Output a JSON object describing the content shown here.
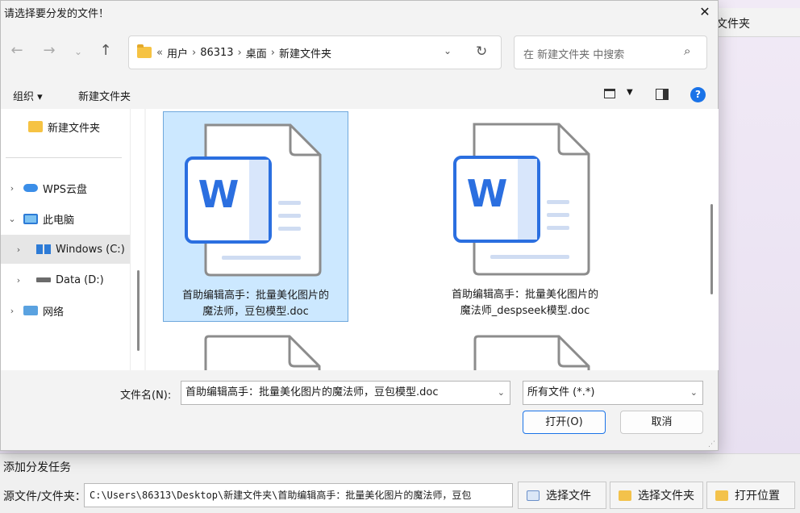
{
  "background": {
    "top_tab_label": "文件夹",
    "task_title": "添加分发任务",
    "source_label": "源文件/文件夹：",
    "source_path": "C:\\Users\\86313\\Desktop\\新建文件夹\\首助编辑高手：批量美化图片的魔法师，豆包",
    "buttons": [
      {
        "label": "选择文件",
        "icon": "doc-icon"
      },
      {
        "label": "选择文件夹",
        "icon": "folder-icon"
      },
      {
        "label": "打开位置",
        "icon": "folder-icon"
      }
    ]
  },
  "dialog": {
    "title": "请选择要分发的文件！",
    "close_glyph": "✕",
    "address": {
      "overflow": "«",
      "crumbs": [
        "用户",
        "86313",
        "桌面",
        "新建文件夹"
      ]
    },
    "search_placeholder": "在 新建文件夹 中搜索",
    "toolbar": {
      "organize": "组织 ▾",
      "new_folder": "新建文件夹"
    },
    "nav_items": [
      {
        "label": "新建文件夹",
        "icon": "folder",
        "chevron": ""
      },
      {
        "label": "WPS云盘",
        "icon": "cloud",
        "chevron": "›"
      },
      {
        "label": "此电脑",
        "icon": "pc",
        "chevron": "⌄"
      },
      {
        "label": "Windows (C:)",
        "icon": "win",
        "chevron": "›",
        "selected": true
      },
      {
        "label": "Data (D:)",
        "icon": "drive",
        "chevron": "›"
      },
      {
        "label": "网络",
        "icon": "net",
        "chevron": "›"
      }
    ],
    "files": [
      {
        "line1": "首助编辑高手：批量美化图片的",
        "line2": "魔法师，豆包模型.doc",
        "selected": true
      },
      {
        "line1": "首助编辑高手：批量美化图片的",
        "line2": "魔法师_despseek模型.doc",
        "selected": false
      }
    ],
    "doc_letter": "W",
    "filename_label": "文件名(N):",
    "filename_value": "首助编辑高手：批量美化图片的魔法师，豆包模型.doc",
    "filetype_value": "所有文件 (*.*)",
    "open_button": "打开(O)",
    "cancel_button": "取消"
  },
  "colors": {
    "accent": "#1a73e8",
    "selection": "#cce8ff",
    "word_blue": "#2b6fe0"
  }
}
